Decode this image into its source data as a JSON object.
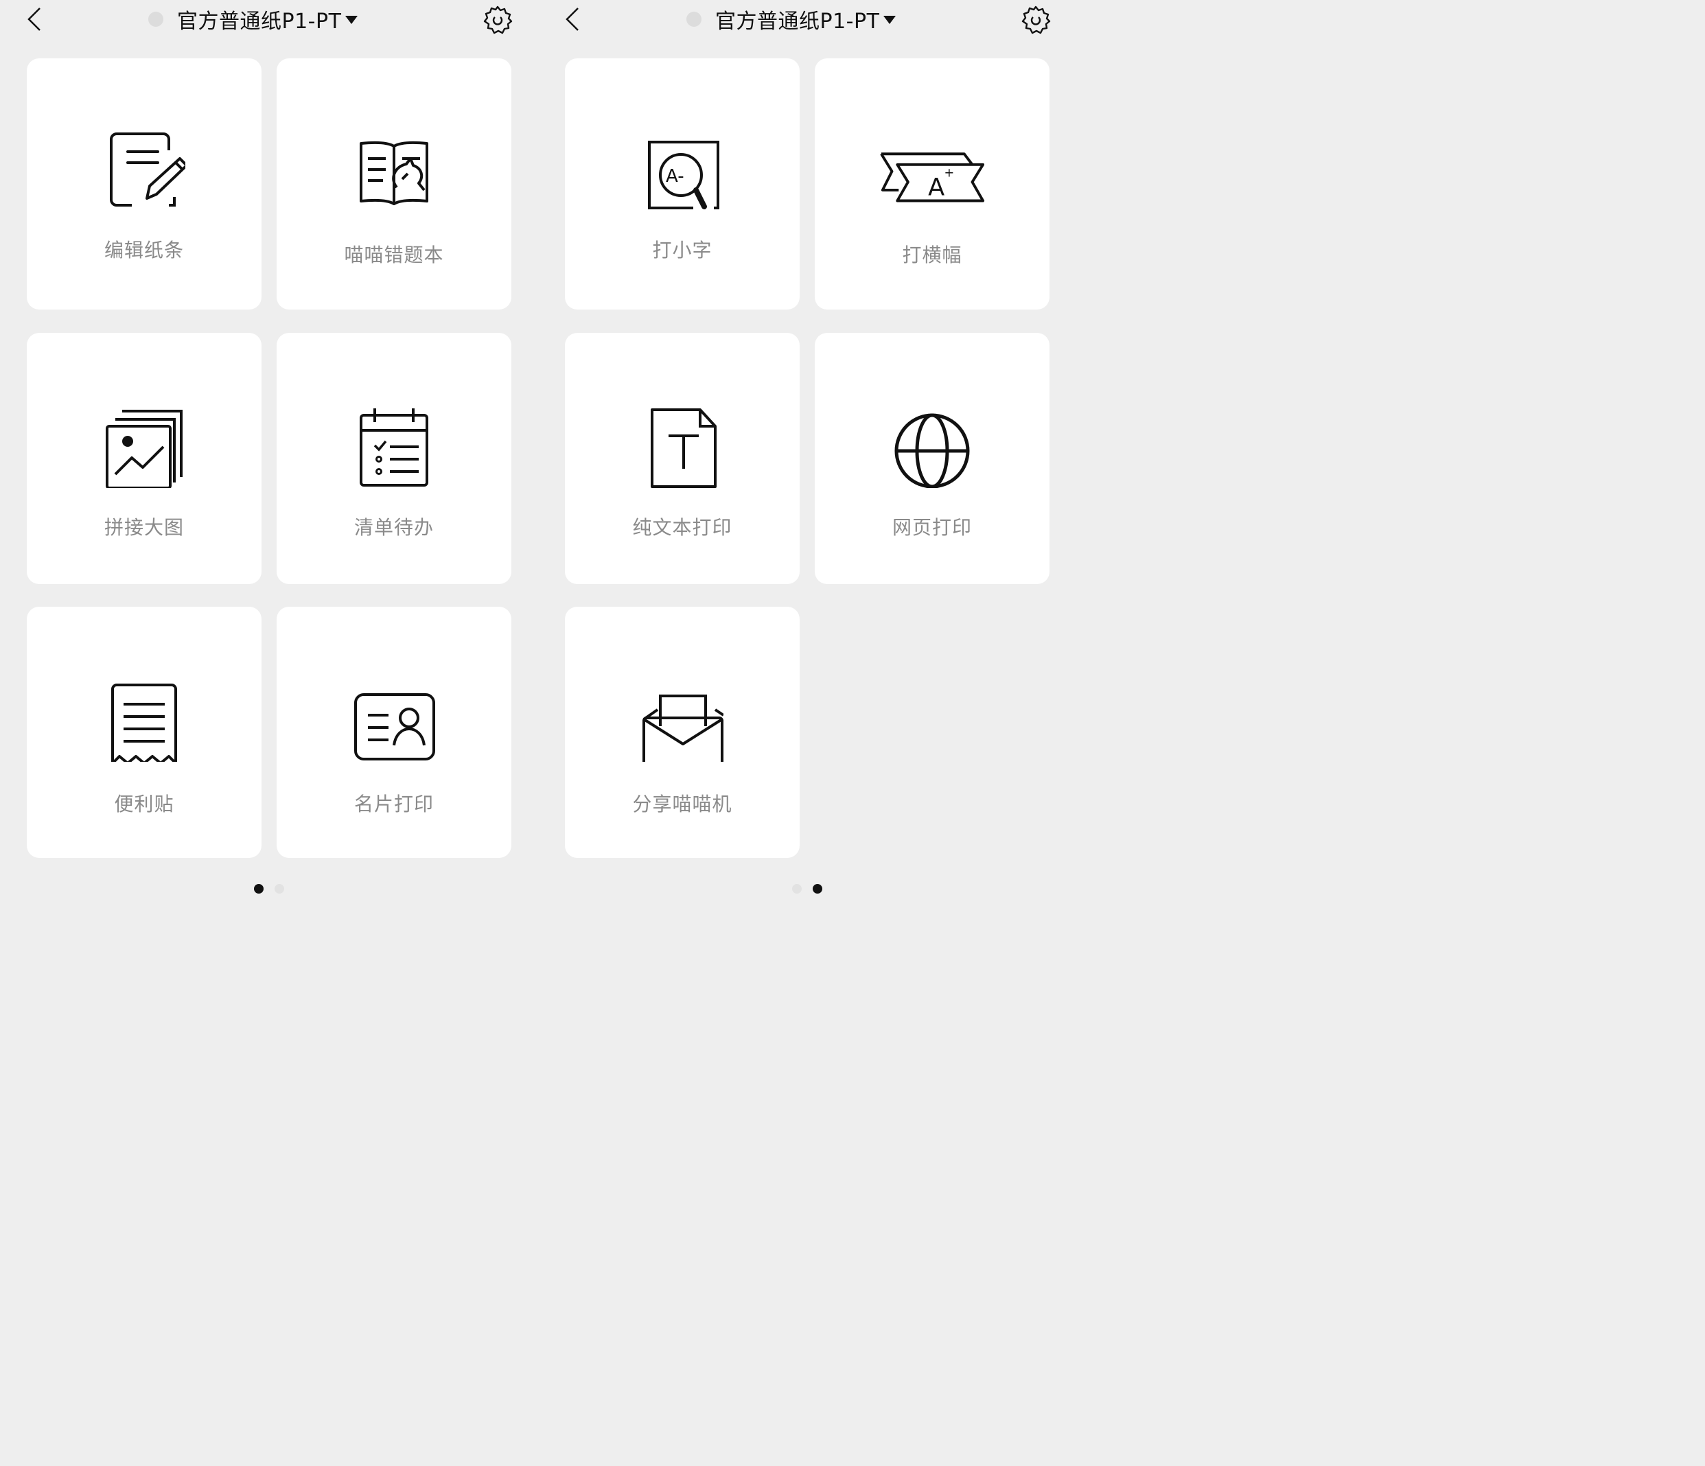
{
  "pages": [
    {
      "header": {
        "title": "官方普通纸P1-PT",
        "back_icon": "chevron-left-icon",
        "settings_icon": "gear-icon"
      },
      "cards": [
        {
          "label": "编辑纸条",
          "icon": "note-edit-icon"
        },
        {
          "label": "喵喵错题本",
          "icon": "mistake-book-icon"
        },
        {
          "label": "拼接大图",
          "icon": "image-stitch-icon"
        },
        {
          "label": "清单待办",
          "icon": "todo-calendar-icon"
        },
        {
          "label": "便利贴",
          "icon": "receipt-note-icon"
        },
        {
          "label": "名片打印",
          "icon": "business-card-icon"
        }
      ],
      "pagination": {
        "current": 1,
        "total": 2
      }
    },
    {
      "header": {
        "title": "官方普通纸P1-PT",
        "back_icon": "chevron-left-icon",
        "settings_icon": "gear-icon"
      },
      "cards": [
        {
          "label": "打小字",
          "icon": "small-text-magnifier-icon"
        },
        {
          "label": "打横幅",
          "icon": "banner-icon"
        },
        {
          "label": "纯文本打印",
          "icon": "text-document-icon"
        },
        {
          "label": "网页打印",
          "icon": "globe-icon"
        },
        {
          "label": "分享喵喵机",
          "icon": "envelope-share-icon"
        }
      ],
      "pagination": {
        "current": 2,
        "total": 2
      }
    }
  ],
  "colors": {
    "background": "#eeeeee",
    "card": "#ffffff",
    "label": "#8a8a8a",
    "icon_stroke": "#111111",
    "dot_active": "#111111",
    "dot_inactive": "#e2e2e2"
  }
}
